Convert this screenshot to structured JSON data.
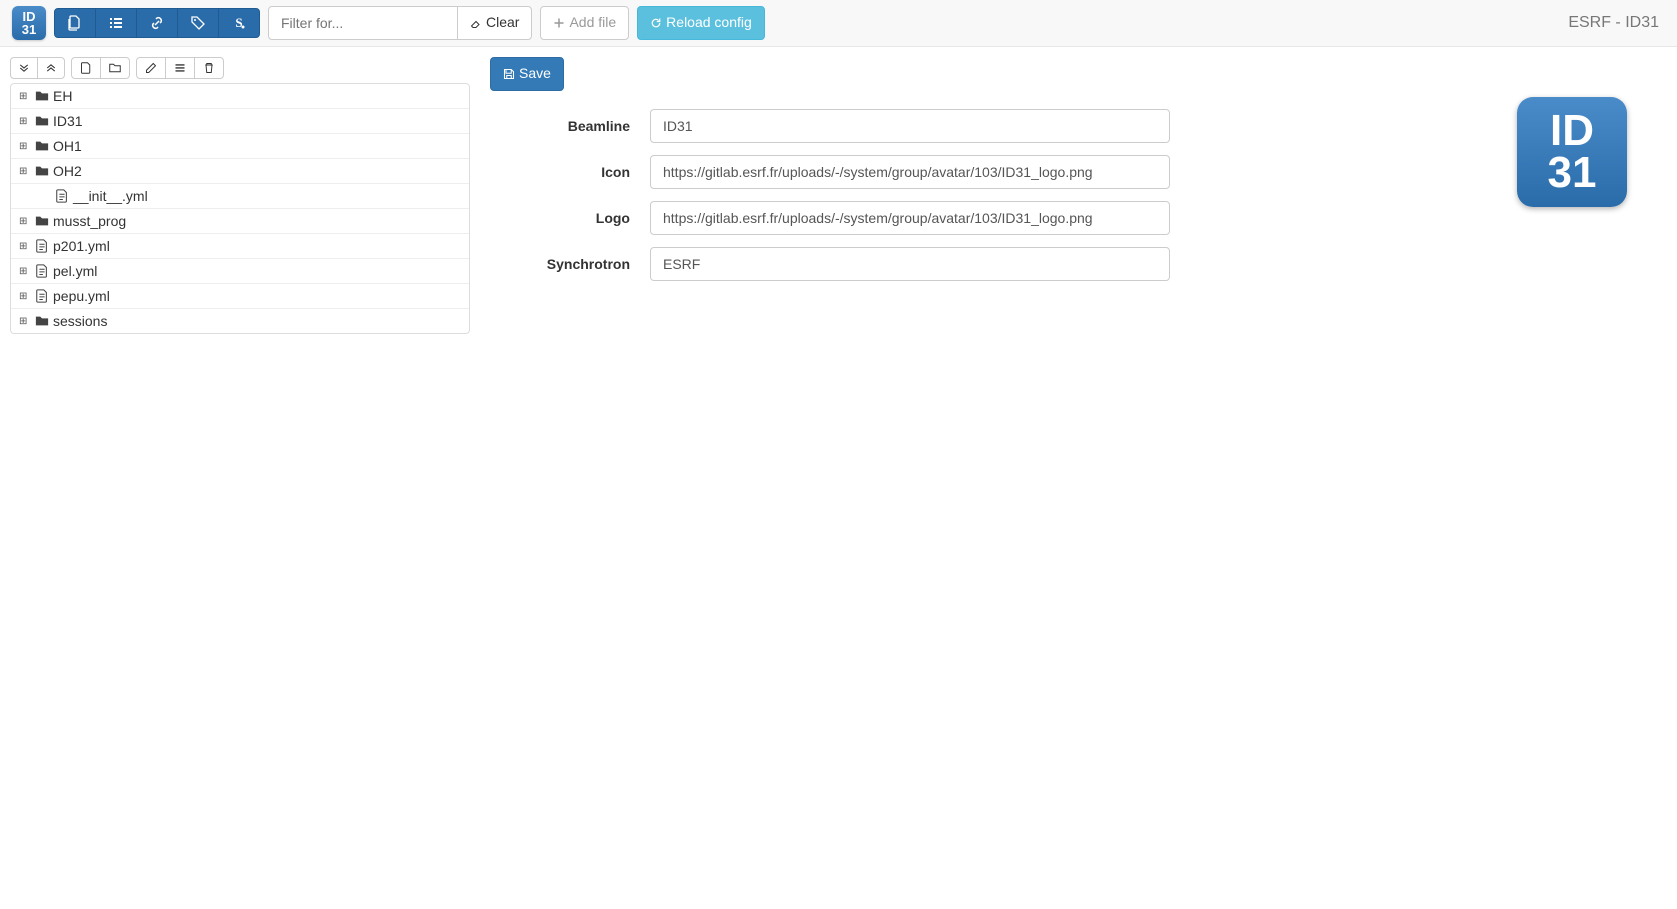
{
  "header": {
    "logo_top": "ID",
    "logo_bottom": "31",
    "title": "ESRF - ID31",
    "filter_placeholder": "Filter for...",
    "clear_label": "Clear",
    "add_file_label": "Add file",
    "reload_label": "Reload config"
  },
  "tree": {
    "nodes": [
      {
        "type": "folder",
        "label": "EH",
        "expandable": true,
        "indent": 0
      },
      {
        "type": "folder",
        "label": "ID31",
        "expandable": true,
        "indent": 0
      },
      {
        "type": "folder",
        "label": "OH1",
        "expandable": true,
        "indent": 0
      },
      {
        "type": "folder",
        "label": "OH2",
        "expandable": true,
        "indent": 0
      },
      {
        "type": "file",
        "label": "__init__.yml",
        "expandable": false,
        "indent": 1
      },
      {
        "type": "folder",
        "label": "musst_prog",
        "expandable": true,
        "indent": 0
      },
      {
        "type": "file",
        "label": "p201.yml",
        "expandable": true,
        "indent": 0
      },
      {
        "type": "file",
        "label": "pel.yml",
        "expandable": true,
        "indent": 0
      },
      {
        "type": "file",
        "label": "pepu.yml",
        "expandable": true,
        "indent": 0
      },
      {
        "type": "folder",
        "label": "sessions",
        "expandable": true,
        "indent": 0
      }
    ]
  },
  "form": {
    "save_label": "Save",
    "fields": [
      {
        "label": "Beamline",
        "value": "ID31"
      },
      {
        "label": "Icon",
        "value": "https://gitlab.esrf.fr/uploads/-/system/group/avatar/103/ID31_logo.png"
      },
      {
        "label": "Logo",
        "value": "https://gitlab.esrf.fr/uploads/-/system/group/avatar/103/ID31_logo.png"
      },
      {
        "label": "Synchrotron",
        "value": "ESRF"
      }
    ]
  },
  "preview": {
    "top": "ID",
    "bottom": "31"
  }
}
